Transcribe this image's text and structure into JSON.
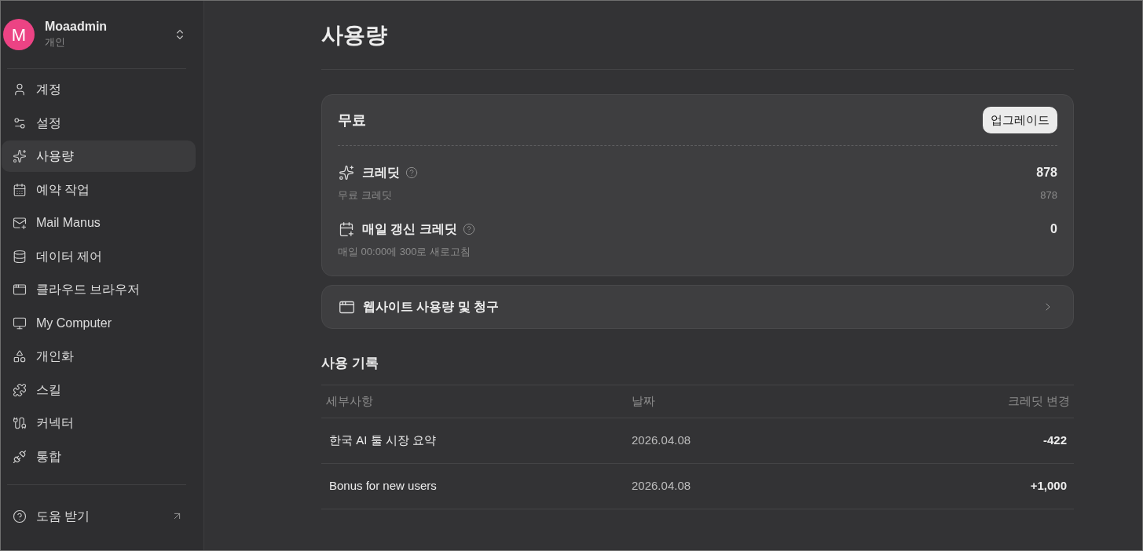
{
  "sidebar": {
    "account": {
      "avatar_letter": "M",
      "name": "Moaadmin",
      "plan": "개인"
    },
    "items": [
      {
        "label": "계정",
        "selected": false
      },
      {
        "label": "설정",
        "selected": false
      },
      {
        "label": "사용량",
        "selected": true
      },
      {
        "label": "예약 작업",
        "selected": false
      },
      {
        "label": "Mail Manus",
        "selected": false
      },
      {
        "label": "데이터 제어",
        "selected": false
      },
      {
        "label": "클라우드 브라우저",
        "selected": false
      },
      {
        "label": "My Computer",
        "selected": false
      },
      {
        "label": "개인화",
        "selected": false
      },
      {
        "label": "스킬",
        "selected": false
      },
      {
        "label": "커넥터",
        "selected": false
      },
      {
        "label": "통합",
        "selected": false
      }
    ],
    "help_link": {
      "label": "도움 받기"
    }
  },
  "page": {
    "title": "사용량"
  },
  "plan_card": {
    "plan": "무료",
    "upgrade_button": "업그레이드",
    "credits": [
      {
        "label": "크레딧",
        "value": "878",
        "detail": "무료 크레딧",
        "detail_value": "878"
      },
      {
        "label": "매일 갱신 크레딧",
        "value": "0",
        "detail": "매일 00:00에 300로 새로고침"
      }
    ]
  },
  "billing_link": {
    "label": "웹사이트 사용량 및 청구"
  },
  "usage_history": {
    "title": "사용 기록",
    "columns": [
      "세부사항",
      "날짜",
      "크레딧 변경"
    ],
    "rows": [
      {
        "details": "한국 AI 툴 시장 요약",
        "date": "2026.04.08",
        "change": "-422"
      },
      {
        "details": "Bonus for new users",
        "date": "2026.04.08",
        "change": "+1,000"
      }
    ]
  }
}
